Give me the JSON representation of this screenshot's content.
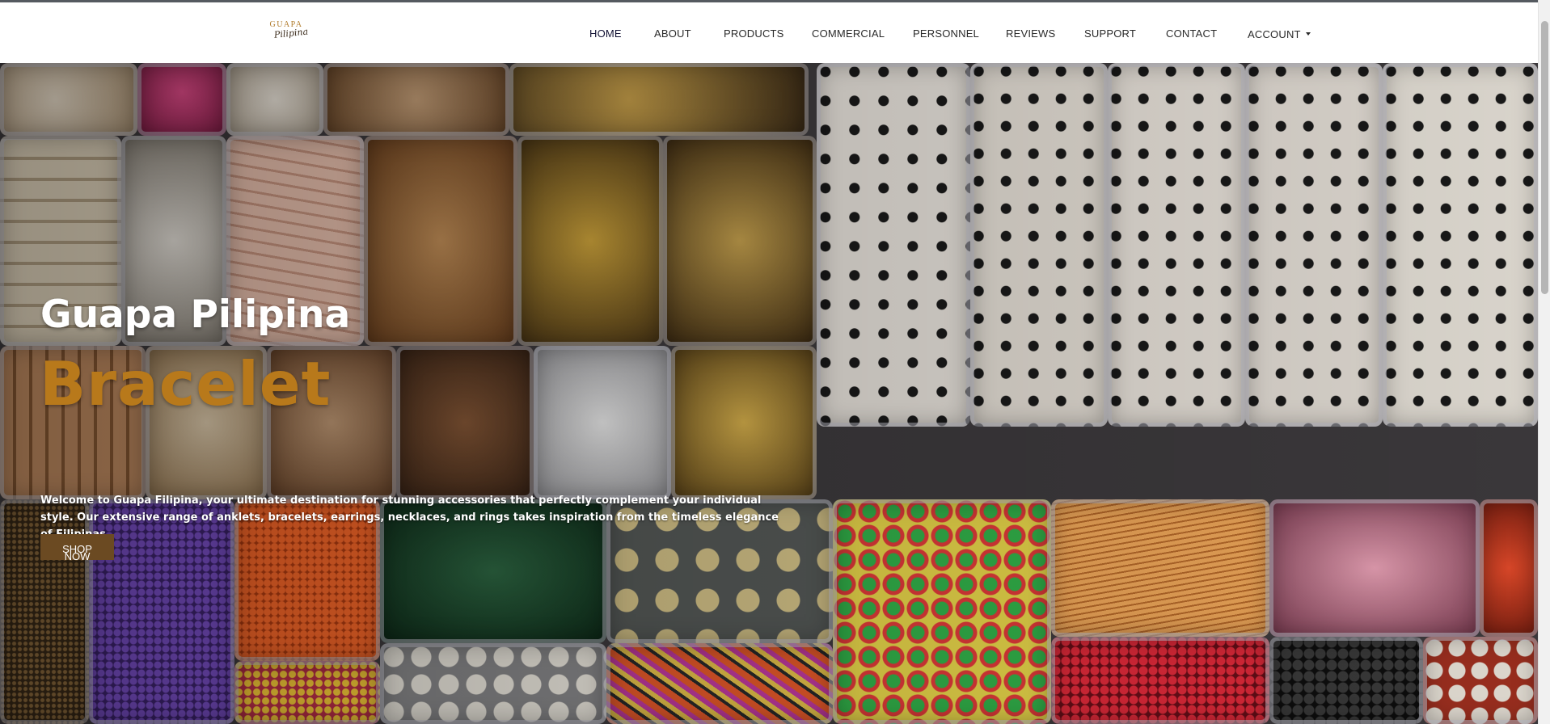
{
  "brand": {
    "logo_line1": "GUAPA",
    "logo_line2": "Pilipina"
  },
  "nav": {
    "items": [
      {
        "label": "HOME",
        "active": true
      },
      {
        "label": "ABOUT"
      },
      {
        "label": "PRODUCTS"
      },
      {
        "label": "COMMERCIAL"
      },
      {
        "label": "PERSONNEL"
      },
      {
        "label": "REVIEWS"
      },
      {
        "label": "SUPPORT"
      },
      {
        "label": "CONTACT"
      }
    ],
    "account_label": "ACCOUNT"
  },
  "hero": {
    "title": "Guapa Pilipina",
    "subtitle": "Bracelet",
    "description": "Welcome to Guapa Filipina, your ultimate destination for stunning accessories that perfectly complement your individual style. Our extensive range of anklets, bracelets, earrings, necklaces, and rings takes inspiration from the timeless elegance of Filipinas.",
    "cta_line1": "SHOP",
    "cta_line2": "NOW",
    "background": "bead-organizer-photo"
  },
  "colors": {
    "accent_gold": "#b8791b",
    "button_brown": "#6b4a22",
    "nav_text": "#2a2a2a"
  }
}
